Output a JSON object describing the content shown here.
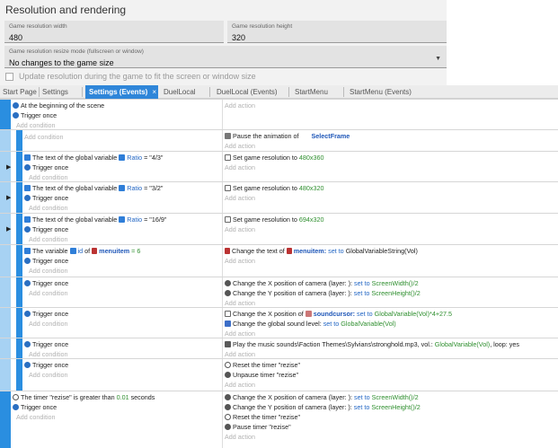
{
  "settings": {
    "title": "Resolution and rendering",
    "width_label": "Game resolution width",
    "width_value": "480",
    "height_label": "Game resolution height",
    "height_value": "320",
    "resize_label": "Game resolution resize mode (fullscreen or window)",
    "resize_value": "No changes to the game size",
    "update_label": "Update resolution during the game to fit the screen or window size"
  },
  "tabs": [
    {
      "label": "Start Page"
    },
    {
      "label": "Settings"
    },
    {
      "label": "Settings (Events)"
    },
    {
      "label": "DuelLocal"
    },
    {
      "label": "DuelLocal (Events)"
    },
    {
      "label": "StartMenu"
    },
    {
      "label": "StartMenu (Events)"
    }
  ],
  "tab_close": "×",
  "common": {
    "add_action": "Add action",
    "add_condition": "Add condition",
    "trigger_once": "Trigger once"
  },
  "events": {
    "e1": {
      "cond": "At the beginning of the scene"
    },
    "e2": {
      "act_pre": "Pause the animation of",
      "act_obj": "SelectFrame"
    },
    "e3": {
      "cond_pre": "The text of the global variable",
      "cond_var": "Ratio",
      "cond_post": "= \"4/3\"",
      "act_pre": "Set game resolution to",
      "act_val": "480x360"
    },
    "e4": {
      "cond_pre": "The text of the global variable",
      "cond_var": "Ratio",
      "cond_post": "= \"3/2\"",
      "act_pre": "Set game resolution to",
      "act_val": "480x320"
    },
    "e5": {
      "cond_pre": "The text of the global variable",
      "cond_var": "Ratio",
      "cond_post": "= \"16/9\"",
      "act_pre": "Set game resolution to",
      "act_val": "694x320"
    },
    "e6": {
      "cond_pre": "The variable",
      "cond_var": "id",
      "cond_mid": "of",
      "cond_obj": "menuitem",
      "cond_post": "= 6",
      "act_pre": "Change the text of",
      "act_obj": "menuitem:",
      "act_set": "set to",
      "act_val": "GlobalVariableString(Vol)"
    },
    "e7": {
      "act1_pre": "Change the X position of camera  (layer: ):",
      "act1_set": "set to",
      "act1_val": "ScreenWidth()/2",
      "act2_pre": "Change the Y position of camera  (layer: ):",
      "act2_set": "set to",
      "act2_val": "ScreenHeight()/2"
    },
    "e8": {
      "act1_pre": "Change the X position of",
      "act1_obj": "soundcursor:",
      "act1_set": "set to",
      "act1_val": "GlobalVariable(Vol)*4+27.5",
      "act2_pre": "Change the global sound level:",
      "act2_set": "set to",
      "act2_val": "GlobalVariable(Vol)"
    },
    "e9": {
      "act_pre": "Play the music sounds\\Faction Themes\\Sylvians\\stronghold.mp3, vol.:",
      "act_val": "GlobalVariable(Vol)",
      "act_post": ", loop: yes"
    },
    "e10": {
      "act1": "Reset the timer  \"rezise\"",
      "act2": "Unpause timer  \"rezise\""
    },
    "e11": {
      "cond_pre": "The timer  \"rezise\" is greater than",
      "cond_val": "0.01",
      "cond_post": "seconds",
      "act1_pre": "Change the X position of camera  (layer: ):",
      "act1_set": "set to",
      "act1_val": "ScreenWidth()/2",
      "act2_pre": "Change the Y position of camera  (layer: ):",
      "act2_set": "set to",
      "act2_val": "ScreenHeight()/2",
      "act3": "Reset the timer  \"rezise\"",
      "act4": "Pause timer  \"rezise\""
    }
  },
  "colors": {
    "accent": "#2f86d9",
    "event_bar": "#2a8ee0",
    "value_green": "#2f8f2f"
  }
}
